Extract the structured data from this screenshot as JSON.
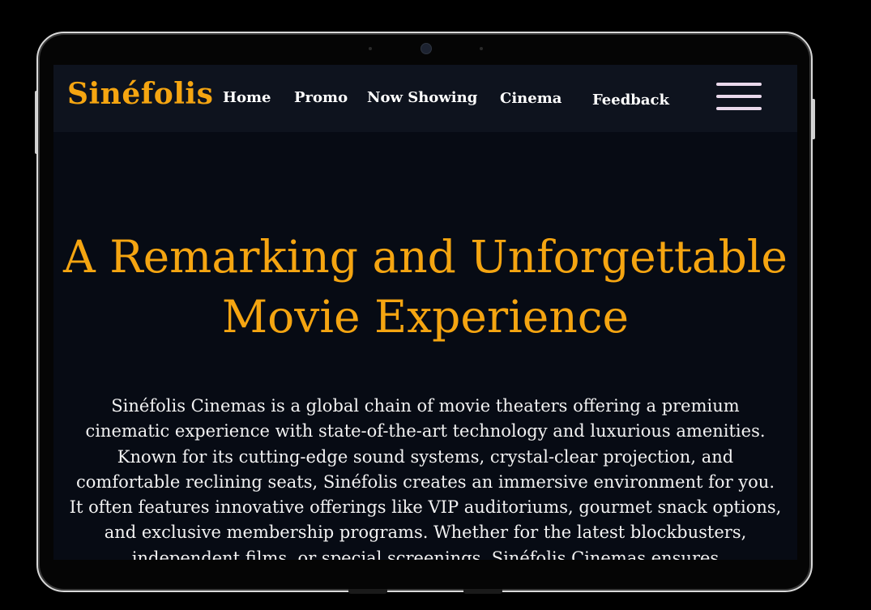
{
  "brand": {
    "name": "Sinéfolis",
    "accent_color": "#f5a511"
  },
  "nav": {
    "items": [
      "Home",
      "Promo",
      "Now Showing",
      "Cinema",
      "Feedback"
    ],
    "menu_icon": "hamburger-menu-icon"
  },
  "hero": {
    "title_line1": "A Remarking and Unforgettable",
    "title_line2": "Movie Experience",
    "description": "Sinéfolis Cinemas is a global chain of movie theaters offering a premium cinematic experience with state-of-the-art technology and luxurious amenities. Known for its cutting-edge sound systems, crystal-clear projection, and comfortable reclining seats, Sinéfolis creates an immersive environment for you. It often features innovative offerings like VIP auditoriums, gourmet snack options, and exclusive membership programs. Whether for the latest blockbusters, independent films, or special screenings, Sinéfolis Cinemas ensures"
  }
}
